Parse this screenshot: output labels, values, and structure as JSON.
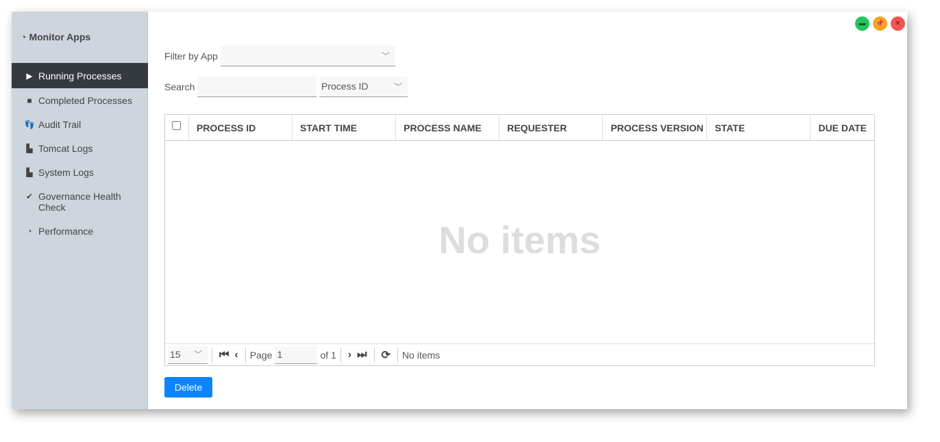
{
  "sidebar": {
    "title": "Monitor Apps",
    "items": [
      {
        "label": "Running Processes",
        "icon": "play-icon"
      },
      {
        "label": "Completed Processes",
        "icon": "stop-icon"
      },
      {
        "label": "Audit Trail",
        "icon": "footprints-icon"
      },
      {
        "label": "Tomcat Logs",
        "icon": "scroll-icon"
      },
      {
        "label": "System Logs",
        "icon": "scroll-icon"
      },
      {
        "label": "Governance Health Check",
        "icon": "check-circle-icon"
      },
      {
        "label": "Performance",
        "icon": "gauge-icon"
      }
    ]
  },
  "filter": {
    "label": "Filter by App",
    "value": ""
  },
  "search": {
    "label": "Search",
    "value": "",
    "field": "Process ID"
  },
  "table": {
    "columns": [
      "PROCESS ID",
      "START TIME",
      "PROCESS NAME",
      "REQUESTER",
      "PROCESS VERSION",
      "STATE",
      "DUE DATE"
    ],
    "empty": "No items"
  },
  "pager": {
    "page_size": "15",
    "page_label": "Page",
    "page": "1",
    "of": "of 1",
    "status": "No items"
  },
  "actions": {
    "delete": "Delete"
  },
  "colors": {
    "accent": "#0a84ff",
    "active": "#343a40"
  }
}
